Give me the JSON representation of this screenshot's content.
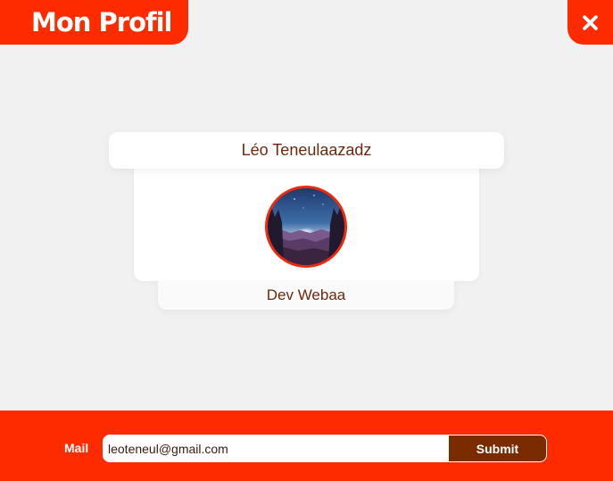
{
  "header": {
    "title": "Mon Profil",
    "close_icon": "close-icon"
  },
  "profile": {
    "name": "Léo Teneulaazadz",
    "role": "Dev Webaa",
    "avatar_icon": "avatar-night-landscape"
  },
  "footer": {
    "mail_label": "Mail",
    "mail_value": "leoteneul@gmail.com",
    "submit_label": "Submit"
  },
  "colors": {
    "accent": "#ff2b00",
    "button_dark": "#7a2b00",
    "text_brown": "#6b2a10",
    "background": "#f1f1f1"
  }
}
